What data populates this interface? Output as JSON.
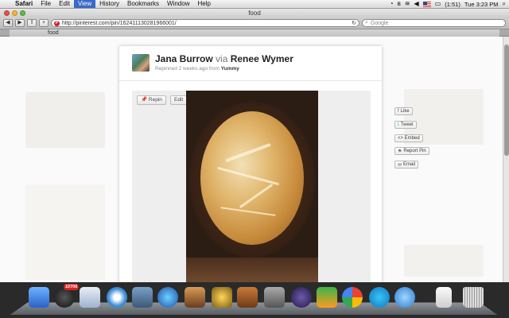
{
  "menubar": {
    "app": "Safari",
    "items": [
      "File",
      "Edit",
      "View",
      "History",
      "Bookmarks",
      "Window",
      "Help"
    ],
    "active_item": "View",
    "battery": "(1:51)",
    "clock": "Tue 3:23 PM"
  },
  "window": {
    "title": "food"
  },
  "toolbar": {
    "url": "http://pinterest.com/pin/162411130281966001/",
    "search_placeholder": "Google"
  },
  "tab": {
    "label": "food"
  },
  "pin": {
    "user": "Jana Burrow",
    "via": "via",
    "source_user": "Renee Wymer",
    "subtitle_prefix": "Repinned 2 weeks ago from",
    "subtitle_board": "Yummy",
    "repin_label": "Repin",
    "edit_label": "Edit"
  },
  "social": {
    "like": "Like",
    "tweet": "Tweet",
    "embed": "<> Embed",
    "report": "Report Pin",
    "email": "Email"
  },
  "dock": {
    "mail_badge": "10706"
  },
  "colors": {
    "pinterest_red": "#c8232c",
    "menu_highlight": "#3a68c7"
  }
}
